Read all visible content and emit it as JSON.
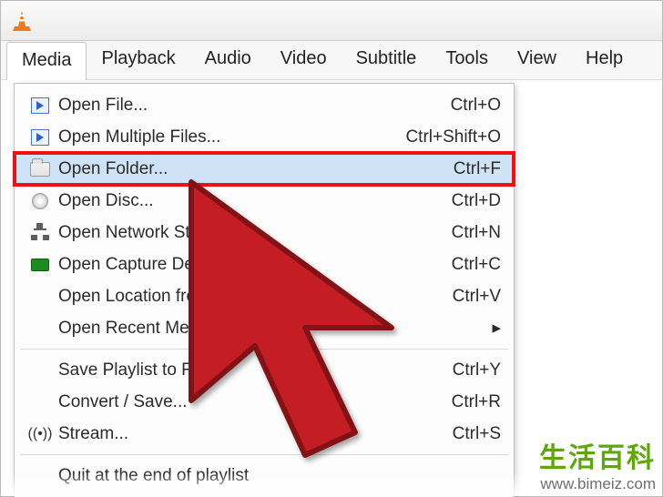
{
  "menubar": {
    "items": [
      "Media",
      "Playback",
      "Audio",
      "Video",
      "Subtitle",
      "Tools",
      "View",
      "Help"
    ],
    "active": "Media"
  },
  "dropdown": {
    "groups": [
      [
        {
          "icon": "play-file-icon",
          "label": "Open File...",
          "shortcut": "Ctrl+O",
          "highlight": false
        },
        {
          "icon": "play-file-icon",
          "label": "Open Multiple Files...",
          "shortcut": "Ctrl+Shift+O",
          "highlight": false
        },
        {
          "icon": "folder-icon",
          "label": "Open Folder...",
          "shortcut": "Ctrl+F",
          "highlight": true,
          "callout": true
        },
        {
          "icon": "disc-icon",
          "label": "Open Disc...",
          "shortcut": "Ctrl+D",
          "highlight": false
        },
        {
          "icon": "network-icon",
          "label": "Open Network Stream...",
          "shortcut": "Ctrl+N",
          "highlight": false
        },
        {
          "icon": "capture-icon",
          "label": "Open Capture Device...",
          "shortcut": "Ctrl+C",
          "highlight": false
        },
        {
          "icon": "",
          "label": "Open Location from clipboard",
          "shortcut": "Ctrl+V",
          "highlight": false
        },
        {
          "icon": "",
          "label": "Open Recent Media",
          "shortcut": "",
          "submenu": true,
          "highlight": false
        }
      ],
      [
        {
          "icon": "",
          "label": "Save Playlist to File...",
          "shortcut": "Ctrl+Y",
          "highlight": false
        },
        {
          "icon": "",
          "label": "Convert / Save...",
          "shortcut": "Ctrl+R",
          "highlight": false
        },
        {
          "icon": "stream-icon",
          "label": "Stream...",
          "shortcut": "Ctrl+S",
          "highlight": false
        }
      ],
      [
        {
          "icon": "",
          "label": "Quit at the end of playlist",
          "shortcut": "",
          "highlight": false
        }
      ]
    ]
  },
  "watermark": {
    "cn": "生活百科",
    "url": "www.bimeiz.com"
  }
}
